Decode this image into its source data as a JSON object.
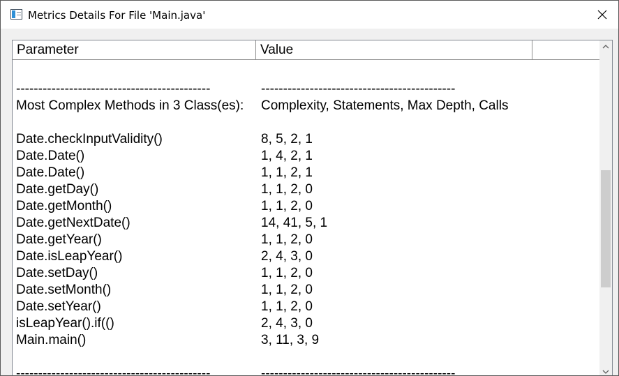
{
  "window": {
    "title": "Metrics Details For File 'Main.java'"
  },
  "icons": {
    "app": "metrics-window-icon",
    "close": "close-icon",
    "scroll_up": "chevron-up-icon",
    "scroll_down": "chevron-down-icon"
  },
  "table": {
    "columns": [
      "Parameter",
      "Value"
    ],
    "rows": [
      [
        "",
        ""
      ],
      [
        "--------------------------------------------",
        "--------------------------------------------"
      ],
      [
        "Most Complex Methods in 3 Class(es):",
        "Complexity, Statements, Max Depth, Calls"
      ],
      [
        "",
        ""
      ],
      [
        "Date.checkInputValidity()",
        "8, 5, 2, 1"
      ],
      [
        "Date.Date()",
        "1, 4, 2, 1"
      ],
      [
        "Date.Date()",
        "1, 1, 2, 1"
      ],
      [
        "Date.getDay()",
        "1, 1, 2, 0"
      ],
      [
        "Date.getMonth()",
        "1, 1, 2, 0"
      ],
      [
        "Date.getNextDate()",
        "14, 41, 5, 1"
      ],
      [
        "Date.getYear()",
        "1, 1, 2, 0"
      ],
      [
        "Date.isLeapYear()",
        "2, 4, 3, 0"
      ],
      [
        "Date.setDay()",
        "1, 1, 2, 0"
      ],
      [
        "Date.setMonth()",
        "1, 1, 2, 0"
      ],
      [
        "Date.setYear()",
        "1, 1, 2, 0"
      ],
      [
        "isLeapYear().if(()",
        "2, 4, 3, 0"
      ],
      [
        "Main.main()",
        "3, 11, 3, 9"
      ],
      [
        "",
        ""
      ],
      [
        "--------------------------------------------",
        "--------------------------------------------"
      ]
    ]
  }
}
